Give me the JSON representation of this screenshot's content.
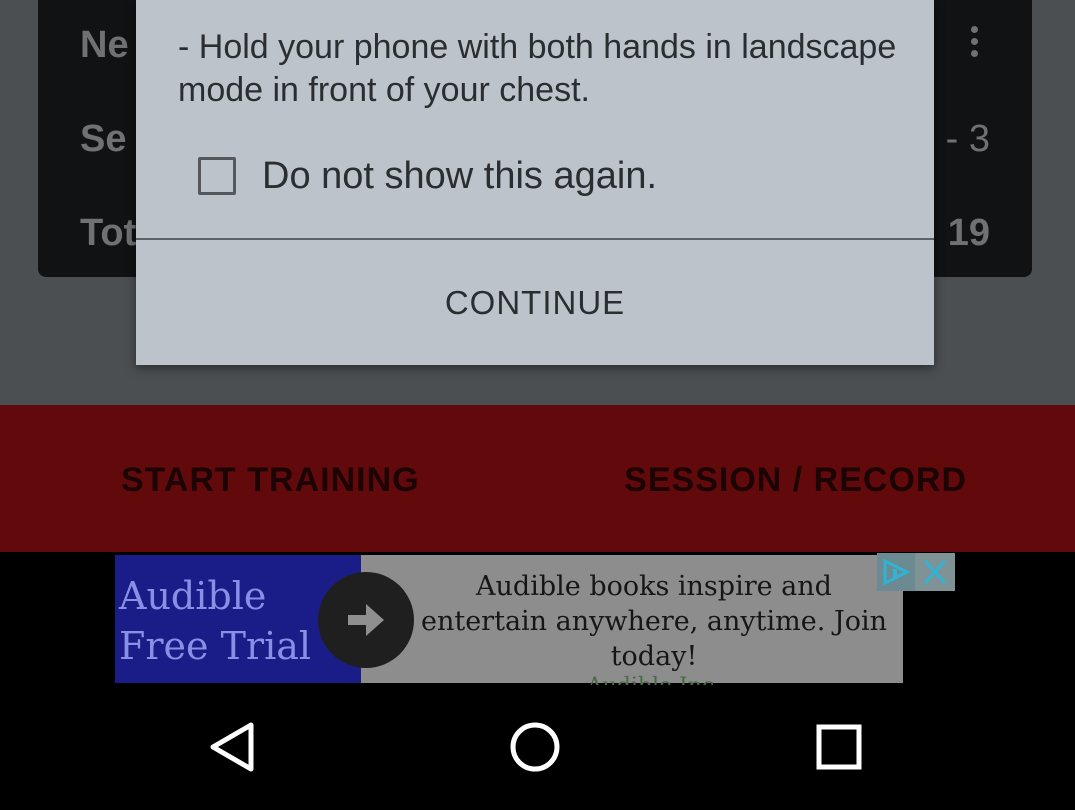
{
  "info_card": {
    "rows": [
      {
        "label": "Ne",
        "value": ""
      },
      {
        "label": "Se",
        "value": "- 3"
      },
      {
        "label": "Tot",
        "value": "19"
      }
    ]
  },
  "dialog": {
    "message": "- Hold your phone with both hands in landscape mode in front of your chest.",
    "checkbox_label": "Do not show this again.",
    "checkbox_checked": false,
    "continue_label": "CONTINUE"
  },
  "actions": {
    "start_training": "START TRAINING",
    "session_record": "SESSION / RECORD"
  },
  "ad": {
    "brand_text": "Audible\nFree Trial",
    "copy": "Audible books inspire and entertain anywhere, anytime. Join today!",
    "advertiser": "Audible Inc."
  },
  "nav": {
    "back_icon": "back-triangle-icon",
    "home_icon": "home-circle-icon",
    "recents_icon": "recents-square-icon"
  },
  "colors": {
    "action_bar": "#620a0b",
    "dialog_bg": "#bcc3cb",
    "ad_brand_block": "#1a1d88"
  }
}
